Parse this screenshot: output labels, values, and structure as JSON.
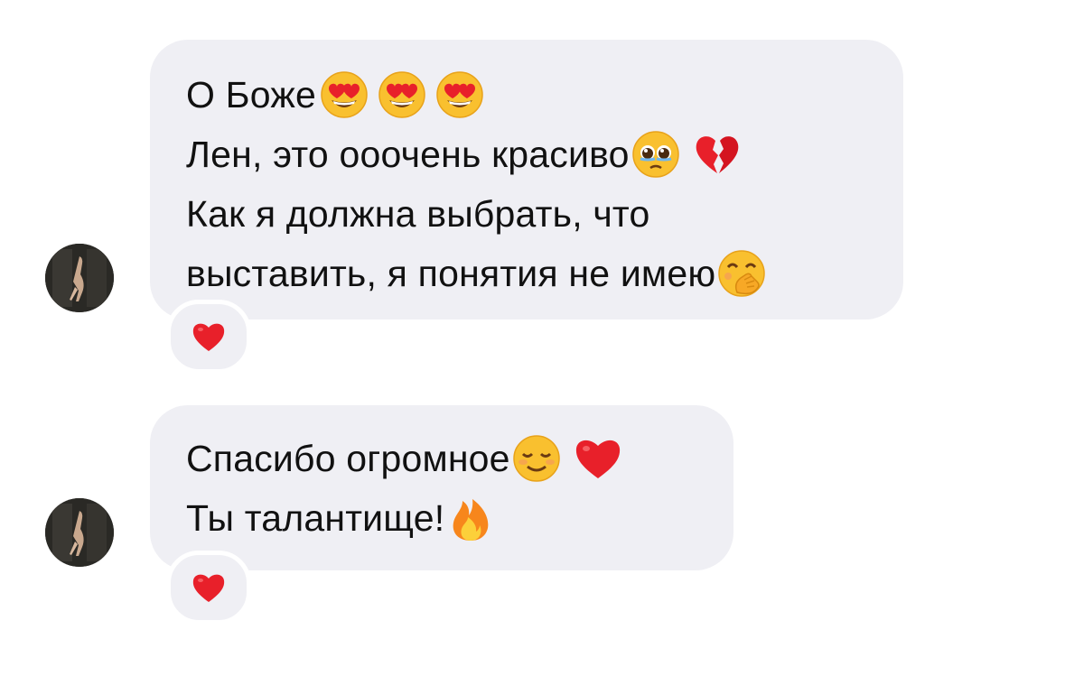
{
  "messages": [
    {
      "lines": [
        {
          "parts": [
            {
              "text": "О Боже"
            },
            {
              "icon": "heart-eyes-emoji"
            },
            {
              "icon": "heart-eyes-emoji"
            },
            {
              "icon": "heart-eyes-emoji"
            }
          ]
        },
        {
          "parts": [
            {
              "text": "Лен, это ооочень красиво"
            },
            {
              "icon": "pleading-face-emoji"
            },
            {
              "icon": "broken-heart-emoji"
            }
          ]
        },
        {
          "parts": [
            {
              "text": "Как я должна выбрать, что"
            }
          ]
        },
        {
          "parts": [
            {
              "text": "выставить, я понятия не имею"
            },
            {
              "icon": "hand-over-mouth-emoji"
            }
          ]
        }
      ],
      "reaction": "red-heart-emoji"
    },
    {
      "lines": [
        {
          "parts": [
            {
              "text": "Спасибо огромное"
            },
            {
              "icon": "smiling-face-emoji"
            },
            {
              "icon": "red-heart-emoji"
            }
          ]
        },
        {
          "parts": [
            {
              "text": "Ты талантище!"
            },
            {
              "icon": "fire-emoji"
            }
          ]
        }
      ],
      "reaction": "red-heart-emoji"
    }
  ],
  "colors": {
    "bubble": "#efeff4",
    "text": "#111111",
    "heart": "#e8202a"
  }
}
